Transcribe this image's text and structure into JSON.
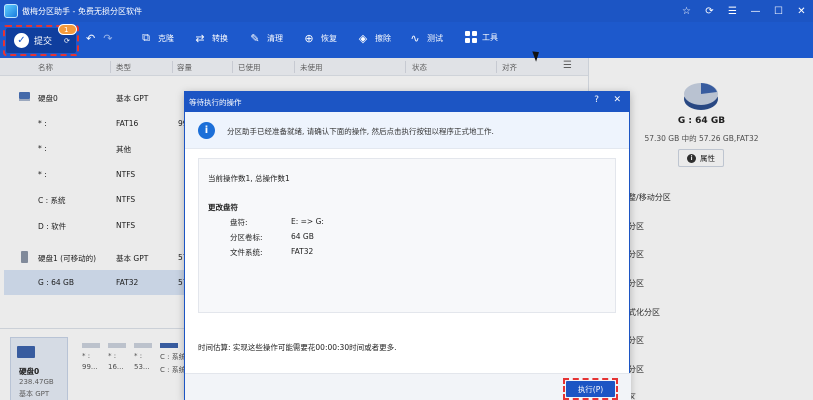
{
  "titlebar": {
    "title": "傲梅分区助手 - 免费无损分区软件",
    "controls": [
      "☆",
      "⟳",
      "☰",
      "—",
      "☐",
      "✕"
    ]
  },
  "toolbar": {
    "submit_label": "提交",
    "pending_badge": "1 ⟳",
    "undo_icon": "↶",
    "redo_icon": "↷",
    "tools": [
      {
        "label": "克隆",
        "icon": "clone-icon"
      },
      {
        "label": "转换",
        "icon": "convert-icon"
      },
      {
        "label": "清理",
        "icon": "clean-icon"
      },
      {
        "label": "恢复",
        "icon": "restore-icon"
      },
      {
        "label": "擦除",
        "icon": "wipe-icon"
      },
      {
        "label": "测试",
        "icon": "test-icon"
      },
      {
        "label": "工具",
        "icon": "tools-icon"
      }
    ]
  },
  "table": {
    "columns": [
      "名称",
      "类型",
      "容量",
      "已使用",
      "未使用",
      "状态",
      "对齐"
    ],
    "rows": [
      {
        "name": "硬盘0",
        "type": "基本 GPT",
        "cap": "",
        "kind": "disk"
      },
      {
        "name": "* :",
        "type": "FAT16",
        "cap": "99",
        "kind": "part"
      },
      {
        "name": "* :",
        "type": "其他",
        "cap": "",
        "kind": "part"
      },
      {
        "name": "* :",
        "type": "NTFS",
        "cap": "",
        "kind": "part"
      },
      {
        "name": "C : 系统",
        "type": "NTFS",
        "cap": "",
        "kind": "part"
      },
      {
        "name": "D : 软件",
        "type": "NTFS",
        "cap": "",
        "kind": "part"
      },
      {
        "name": "硬盘1 (可移动的)",
        "type": "基本 GPT",
        "cap": "57",
        "kind": "usb"
      },
      {
        "name": "G : 64 GB",
        "type": "FAT32",
        "cap": "57",
        "kind": "part"
      }
    ]
  },
  "disk_map": {
    "disk_name": "硬盘0",
    "disk_size": "238.47GB",
    "disk_type": "基本 GPT",
    "parts": [
      {
        "label1": "* :",
        "label2": "99..."
      },
      {
        "label1": "* :",
        "label2": "16..."
      },
      {
        "label1": "* :",
        "label2": "53..."
      },
      {
        "label1": "C : 系统",
        "label2": "C : 系统"
      }
    ]
  },
  "right_panel": {
    "drive_name": "G : 64 GB",
    "drive_info": "57.30 GB 中的 57.26 GB,FAT32",
    "props_label": "属性",
    "ops": [
      "整/移动分区",
      "分区",
      "分区",
      "分区",
      "式化分区",
      "分区",
      "分区",
      "分区",
      "区"
    ]
  },
  "modal": {
    "title": "等待执行的操作",
    "help": "?",
    "close": "✕",
    "banner": "分区助手已经准备就绪, 请确认下面的操作, 然后点击执行按钮以程序正式地工作.",
    "summary": "当前操作数1, 总操作数1",
    "section": "更改盘符",
    "details": [
      {
        "key": "盘符:",
        "value": "E: => G:"
      },
      {
        "key": "分区卷标:",
        "value": "64 GB"
      },
      {
        "key": "文件系统:",
        "value": "FAT32"
      }
    ],
    "estimate": "时间估算: 实现这些操作可能需要花00:00:30时间或者更多.",
    "execute_label": "执行(P)"
  },
  "colors": {
    "brand_blue": "#1c55c4",
    "highlight_red": "#e53333",
    "badge_orange": "#f49a3c",
    "selected_row": "#d9e5f7"
  }
}
